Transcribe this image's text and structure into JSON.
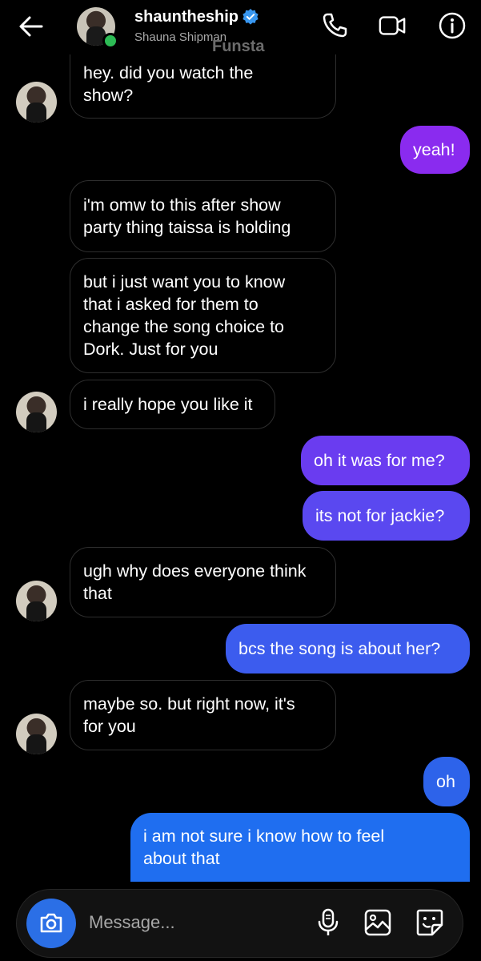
{
  "header": {
    "username": "shauntheship",
    "full_name": "Shauna Shipman",
    "watermark": "Funsta",
    "icons": [
      "back-arrow-icon",
      "verified-badge-icon",
      "phone-icon",
      "video-camera-icon",
      "info-icon"
    ],
    "online": true
  },
  "messages": [
    {
      "sender": "them",
      "text": "hey. did you watch the show?",
      "lines": [
        "hey. did you watch the",
        "show?"
      ]
    },
    {
      "sender": "me",
      "text": "yeah!"
    },
    {
      "sender": "them",
      "text": "i'm omw to this after show party thing taissa is holding",
      "lines": [
        "i'm omw to this after show",
        "party thing taissa is holding"
      ]
    },
    {
      "sender": "them",
      "text": "but i just want you to know that i asked for them to change the song choice to Dork. Just for you",
      "lines": [
        "but i just want you to know",
        "that i asked for them to",
        "change the song choice to",
        "Dork. Just for you"
      ]
    },
    {
      "sender": "them",
      "text": "i really hope you like it"
    },
    {
      "sender": "me",
      "text": "oh it was for me?"
    },
    {
      "sender": "me",
      "text": "its not for jackie?"
    },
    {
      "sender": "them",
      "text": "ugh why does everyone think that",
      "lines": [
        "ugh why does everyone think",
        "that"
      ]
    },
    {
      "sender": "me",
      "text": "bcs the song is about her?"
    },
    {
      "sender": "them",
      "text": "maybe so. but right now, it's for you",
      "lines": [
        "maybe so. but right now, it's",
        "for you"
      ]
    },
    {
      "sender": "me",
      "text": "oh"
    },
    {
      "sender": "me",
      "text": "i am not sure i know how to feel about that",
      "lines": [
        "i am not sure i know how to feel",
        "about that"
      ]
    }
  ],
  "composer": {
    "placeholder": "Message...",
    "icons": [
      "camera-icon",
      "microphone-icon",
      "gallery-icon",
      "sticker-icon"
    ]
  },
  "colors": {
    "background": "#000000",
    "incoming_border": "#2e2e2e",
    "outgoing_gradient": [
      "#8a2bef",
      "#6a3cf0",
      "#4b55ef",
      "#2d63ea",
      "#1f6ef0"
    ],
    "camera_button": "#2b6fe6",
    "online_dot": "#2dbb55",
    "verified": "#3897f0"
  }
}
